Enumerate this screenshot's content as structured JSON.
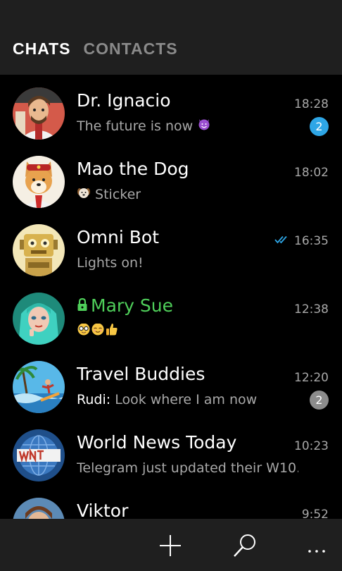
{
  "tabs": [
    {
      "label": "CHATS",
      "active": true
    },
    {
      "label": "CONTACTS",
      "active": false
    }
  ],
  "chats": [
    {
      "name": "Dr. Ignacio",
      "preview": "The future is now",
      "preview_emoji": "smiling-devil-emoji",
      "time": "18:28",
      "unread": "2",
      "badge_color": "#2ea6e6"
    },
    {
      "name": "Mao the Dog",
      "preview_emoji": "dog-face-emoji",
      "preview": "Sticker",
      "time": "18:02"
    },
    {
      "name": "Omni Bot",
      "preview": "Lights on!",
      "time": "16:35",
      "status_icon": "double-check-icon",
      "status_color": "#2ea6e6"
    },
    {
      "name": "Mary Sue",
      "secret": true,
      "name_color": "#4fcf5a",
      "preview_emoji": "nerd-face, relieved-face, thumbs-up",
      "time": "12:38"
    },
    {
      "name": "Travel Buddies",
      "sender": "Rudi:",
      "preview": "Look where I am now",
      "time": "12:20",
      "unread": "2",
      "badge_color": "#8c8c8c"
    },
    {
      "name": "World News Today",
      "preview": "Telegram just updated their W10...",
      "time": "10:23"
    },
    {
      "name": "Viktor",
      "time": "9:52"
    }
  ],
  "app_bar": {
    "icons": [
      "plus-icon",
      "search-icon",
      "more-icon"
    ]
  }
}
